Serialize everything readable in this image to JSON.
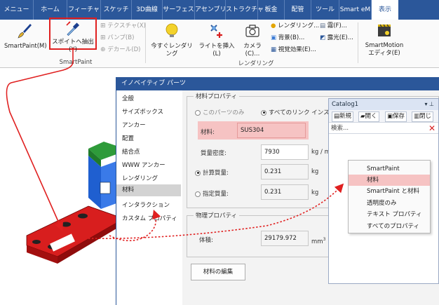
{
  "ribbon_tabs": [
    "メニュー",
    "ホーム",
    "フィーチャ",
    "スケッチ",
    "3D曲線",
    "サーフェス",
    "アセンブリ",
    "ストラクチャ",
    "板金",
    "配管",
    "ツール",
    "Smart eM",
    "表示"
  ],
  "ribbon": {
    "smartpaint_label": "SmartPaint(M)",
    "eyedropper_label": "スポイトへ抽出(Y)",
    "texture_label": "テクスチャ(X)",
    "bump_label": "バンプ(B)",
    "decal_label": "デカール(D)",
    "group_smartpaint": "SmartPaint",
    "render_now_label": "今すぐレンダリング",
    "insert_light_label": "ライトを挿入(L)",
    "camera_label": "カメラ(C)...",
    "rendering_label": "レンダリング...",
    "background_label": "背景(B)...",
    "visual_effects_label": "視覚効果(E)...",
    "fog_label": "霧(F)...",
    "exposure_label": "露光(E)...",
    "group_rendering": "レンダリング",
    "smartmotion_label_1": "SmartMotion",
    "smartmotion_label_2": "エディタ(E)"
  },
  "dialog": {
    "title": "イノベイティブ パーツ",
    "sidebar": [
      "全般",
      "サイズボックス",
      "アンカー",
      "配置",
      "結合点",
      "WWW アンカー",
      "レンダリング",
      "材料",
      "インタラクション",
      "カスタム プロパティ"
    ],
    "material_group": "材料プロパティ",
    "radio_this_part": "このパーツのみ",
    "radio_all_links": "すべてのリンク インスタン",
    "material_label": "材料:",
    "material_value": "SUS304",
    "density_label": "質量密度:",
    "density_value": "7930",
    "density_unit": "kg / m",
    "calc_mass_label": "計算質量:",
    "calc_mass_value": "0.231",
    "calc_mass_unit": "kg",
    "spec_mass_label": "指定質量:",
    "spec_mass_value": "0.231",
    "spec_mass_unit": "kg",
    "physical_group": "物理プロパティ",
    "volume_label": "体積:",
    "volume_value": "29179.972",
    "volume_unit": "mm",
    "volume_exp": "3",
    "edit_material_button": "材料の編集"
  },
  "catalog": {
    "title": "Catalog1",
    "pin": "▾ ⊥",
    "btn_new": "新規",
    "btn_open": "開く",
    "btn_save": "保存",
    "btn_close": "閉じ",
    "search_label": "検索..."
  },
  "context_menu": [
    "SmartPaint",
    "材料",
    "SmartPaint と材料",
    "透明度のみ",
    "テキスト プロパティ",
    "すべてのプロパティ"
  ],
  "colors": {
    "accent": "#2b579a",
    "highlight_red": "#e02020",
    "highlight_pink": "#f6c3c3",
    "part_red": "#d81e1e"
  }
}
